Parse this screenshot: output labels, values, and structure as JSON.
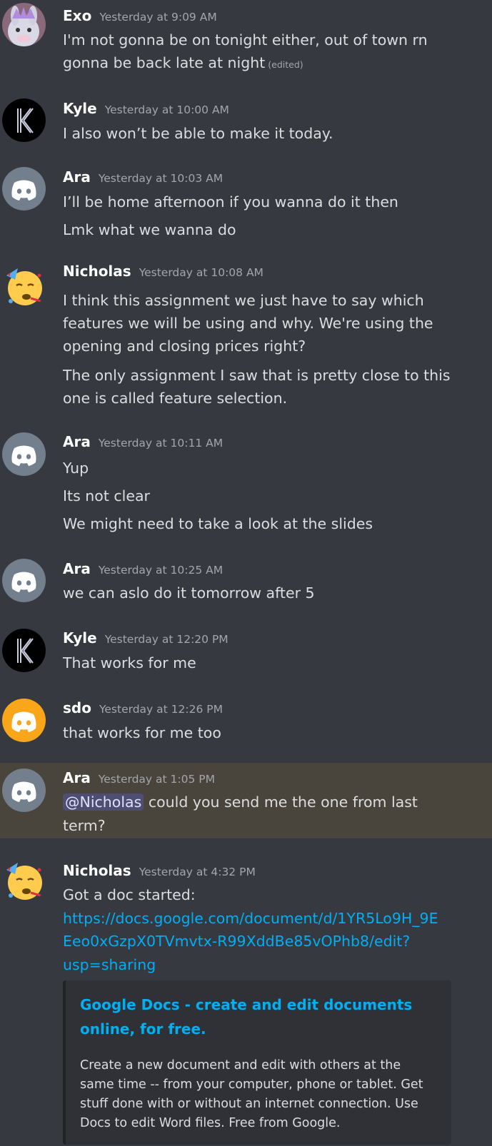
{
  "messages": [
    {
      "author": "Exo",
      "timestamp": "Yesterday at 9:09 AM",
      "lines": [
        "I'm not gonna be on tonight either, out of town rn",
        "gonna be back late at night"
      ],
      "edited": "(edited)"
    },
    {
      "author": "Kyle",
      "timestamp": "Yesterday at 10:00 AM",
      "lines": [
        "I also won’t be able to make it today."
      ]
    },
    {
      "author": "Ara",
      "timestamp": "Yesterday at 10:03 AM",
      "lines": [
        "I’ll be home afternoon if you wanna do it then",
        "Lmk what we wanna do"
      ]
    },
    {
      "author": "Nicholas",
      "timestamp": "Yesterday at 10:08 AM",
      "lines": [
        "I think this assignment we just have to say which",
        "features we will be using and why. We're using the",
        "opening and closing prices right?",
        "The only assignment I saw that is pretty close to this",
        "one is called feature selection."
      ]
    },
    {
      "author": "Ara",
      "timestamp": "Yesterday at 10:11 AM",
      "lines": [
        "Yup",
        "Its not clear",
        "We might need to take a look at the slides"
      ]
    },
    {
      "author": "Ara",
      "timestamp": "Yesterday at 10:25 AM",
      "lines": [
        "we can aslo do it tomorrow after 5"
      ]
    },
    {
      "author": "Kyle",
      "timestamp": "Yesterday at 12:20 PM",
      "lines": [
        "That works for me"
      ]
    },
    {
      "author": "sdo",
      "timestamp": "Yesterday at 12:26 PM",
      "lines": [
        "that works for me too"
      ]
    },
    {
      "author": "Ara",
      "timestamp": "Yesterday at 1:05 PM",
      "mention": "@Nicholas",
      "lines": [
        "could you send me the one from last",
        "term?"
      ]
    },
    {
      "author": "Nicholas",
      "timestamp": "Yesterday at 4:32 PM",
      "lines": [
        "Got a doc started:"
      ],
      "link_lines": [
        "https://docs.google.com/document/d/1YR5Lo9H_9E",
        "Eeo0xGzpX0TVmvtx-R99XddBe85vOPhb8/edit?",
        "usp=sharing"
      ]
    }
  ],
  "embed": {
    "title_lines": [
      "Google Docs - create and edit documents",
      "online, for free."
    ],
    "description": "Create a new document and edit with others at the same time -- from your computer, phone or tablet. Get stuff done with or without an internet connection. Use Docs to edit Word files. Free from Google."
  },
  "colors": {
    "background": "#36393f",
    "mention_highlight": "#49443c",
    "link": "#00aff4",
    "discord_gray": "#747f8d",
    "discord_orange": "#faa61a"
  },
  "icons": {
    "exo": "bunny-king-avatar-icon",
    "kyle": "k-logo-avatar-icon",
    "ara": "discord-logo-avatar-icon",
    "nicholas": "party-emoji-avatar-icon",
    "sdo": "discord-logo-avatar-icon"
  }
}
